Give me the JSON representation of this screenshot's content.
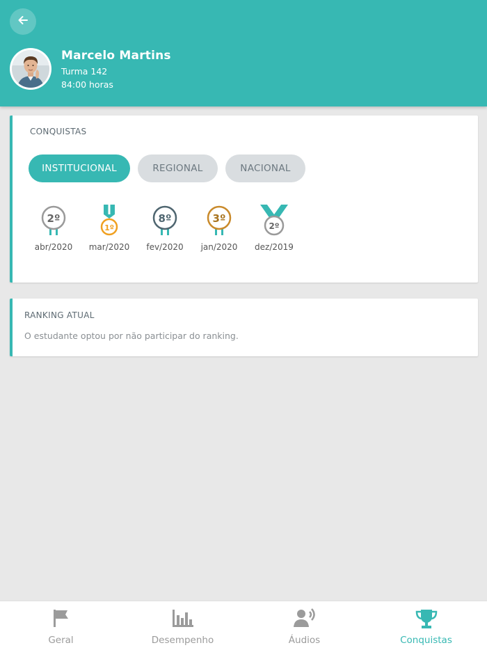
{
  "profile": {
    "name": "Marcelo Martins",
    "class": "Turma 142",
    "hours": "84:00 horas"
  },
  "achievements": {
    "title": "CONQUISTAS",
    "filters": [
      {
        "label": "INSTITUCIONAL",
        "active": true
      },
      {
        "label": "REGIONAL",
        "active": false
      },
      {
        "label": "NACIONAL",
        "active": false
      }
    ],
    "medals": [
      {
        "rank": "2º",
        "label": "abr/2020",
        "color": "#8e8e8e",
        "ribbon": "short"
      },
      {
        "rank": "1º",
        "label": "mar/2020",
        "color": "#f0a020",
        "ribbon": "tall"
      },
      {
        "rank": "8º",
        "label": "fev/2020",
        "color": "#4f6670",
        "ribbon": "short"
      },
      {
        "rank": "3º",
        "label": "jan/2020",
        "color": "#c98a2b",
        "ribbon": "short"
      },
      {
        "rank": "2º",
        "label": "dez/2019",
        "color": "#8e8e8e",
        "ribbon": "wide"
      }
    ]
  },
  "ranking": {
    "title": "RANKING ATUAL",
    "message": "O estudante optou por não participar do ranking."
  },
  "tabs": [
    {
      "label": "Geral",
      "icon": "flag-icon",
      "active": false
    },
    {
      "label": "Desempenho",
      "icon": "bar-chart-icon",
      "active": false
    },
    {
      "label": "Áudios",
      "icon": "speaker-person-icon",
      "active": false
    },
    {
      "label": "Conquistas",
      "icon": "trophy-icon",
      "active": true
    }
  ],
  "colors": {
    "accent": "#37b8b3",
    "background": "#e8e8e8",
    "inactive_pill": "#d9dde0"
  }
}
